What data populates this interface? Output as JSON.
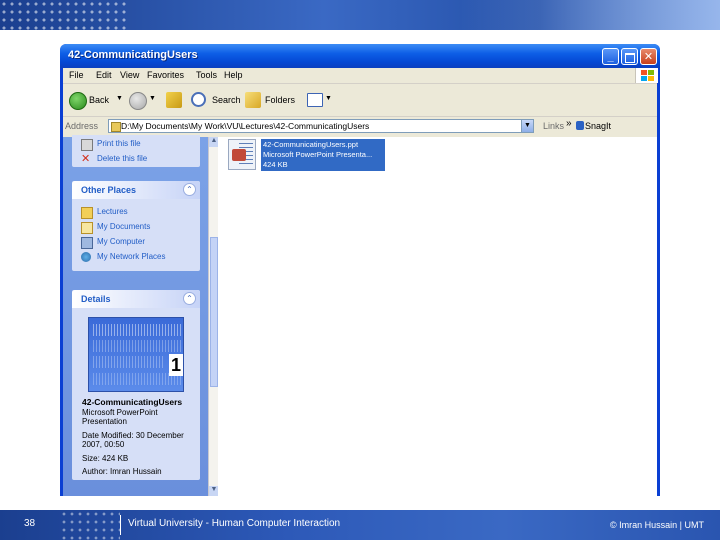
{
  "slide": {
    "number": "38",
    "footer": "Virtual University - Human Computer Interaction",
    "credit": "© Imran Hussain | UMT"
  },
  "window": {
    "title": "42-CommunicatingUsers",
    "menu": [
      "File",
      "Edit",
      "View",
      "Favorites",
      "Tools",
      "Help"
    ],
    "toolbar": {
      "back": "Back",
      "search": "Search",
      "folders": "Folders"
    },
    "address": {
      "label": "Address",
      "value": "D:\\My Documents\\My Work\\VU\\Lectures\\42-CommunicatingUsers",
      "go": "Links",
      "snagit": "SnagIt"
    }
  },
  "taskpane": {
    "file_tasks": [
      "Print this file",
      "Delete this file"
    ],
    "other_places": {
      "title": "Other Places",
      "items": [
        "Lectures",
        "My Documents",
        "My Computer",
        "My Network Places"
      ]
    },
    "details": {
      "title": "Details",
      "thumbnail_number": "1",
      "file_name": "42-CommunicatingUsers",
      "file_type": "Microsoft PowerPoint Presentation",
      "modified": "Date Modified: 30 December 2007, 00:50",
      "size": "Size: 424 KB",
      "author": "Author: Imran Hussain"
    }
  },
  "files": [
    {
      "name": "42-CommunicatingUsers.ppt",
      "type": "Microsoft PowerPoint Presenta...",
      "size": "424 KB",
      "selected": true
    }
  ],
  "colors": {
    "titlebar": "#0548d4",
    "taskpane": "#7ba2e7",
    "selection": "#316ac5",
    "link": "#215dc6"
  }
}
